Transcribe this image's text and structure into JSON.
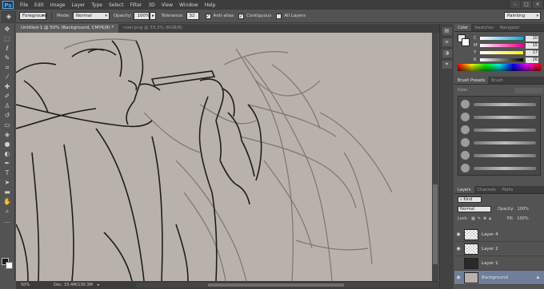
{
  "app": {
    "logo": "Ps"
  },
  "menu": [
    "File",
    "Edit",
    "Image",
    "Layer",
    "Type",
    "Select",
    "Filter",
    "3D",
    "View",
    "Window",
    "Help"
  ],
  "options": {
    "tool_icon": "paint-bucket-icon",
    "source": "Foreground",
    "mode_label": "Mode:",
    "mode": "Normal",
    "opacity_label": "Opacity:",
    "opacity": "100%",
    "tolerance_label": "Tolerance:",
    "tolerance": "32",
    "anti_alias": "Anti-alias",
    "contiguous": "Contiguous",
    "all_layers": "All Layers",
    "workspace": "Painting"
  },
  "documents": {
    "active_tab": "Untitled-1 @ 50% (Background, CMYK/8) *",
    "other_tab": "noel.png @ 33.3% (RGB/8)"
  },
  "status": {
    "zoom": "50%",
    "doc": "Doc: 33.4M/130.3M"
  },
  "color_panel": {
    "tabs": [
      "Color",
      "Swatches",
      "Navigator"
    ],
    "channels": [
      {
        "name": "C",
        "value": "10",
        "gradient": "#00aeef"
      },
      {
        "name": "M",
        "value": "15",
        "gradient": "#ec008c"
      },
      {
        "name": "Y",
        "value": "17",
        "gradient": "#fff200"
      },
      {
        "name": "K",
        "value": "26",
        "gradient": "#000000"
      }
    ]
  },
  "brush_panel": {
    "tabs": [
      "Brush Presets",
      "Brush"
    ],
    "size_label": "Size:"
  },
  "layers_panel": {
    "tabs": [
      "Layers",
      "Channels",
      "Paths"
    ],
    "filter_kind": "Kind",
    "blend_mode": "Normal",
    "opacity_label": "Opacity:",
    "opacity_value": "100%",
    "lock_label": "Lock:",
    "fill_label": "Fill:",
    "fill_value": "100%",
    "layers": [
      {
        "name": "Layer 4",
        "thumb": "checker",
        "visible": true
      },
      {
        "name": "Layer 2",
        "thumb": "checker",
        "visible": true
      },
      {
        "name": "Layer 1",
        "thumb": "sketch",
        "visible": false
      },
      {
        "name": "Background",
        "thumb": "bg",
        "visible": true,
        "selected": true,
        "locked": true
      }
    ]
  },
  "colors": {
    "chrome_dark": "#3c3c3c",
    "chrome": "#535353",
    "canvas": "#b9b2aa",
    "selection": "#6f7f99"
  }
}
